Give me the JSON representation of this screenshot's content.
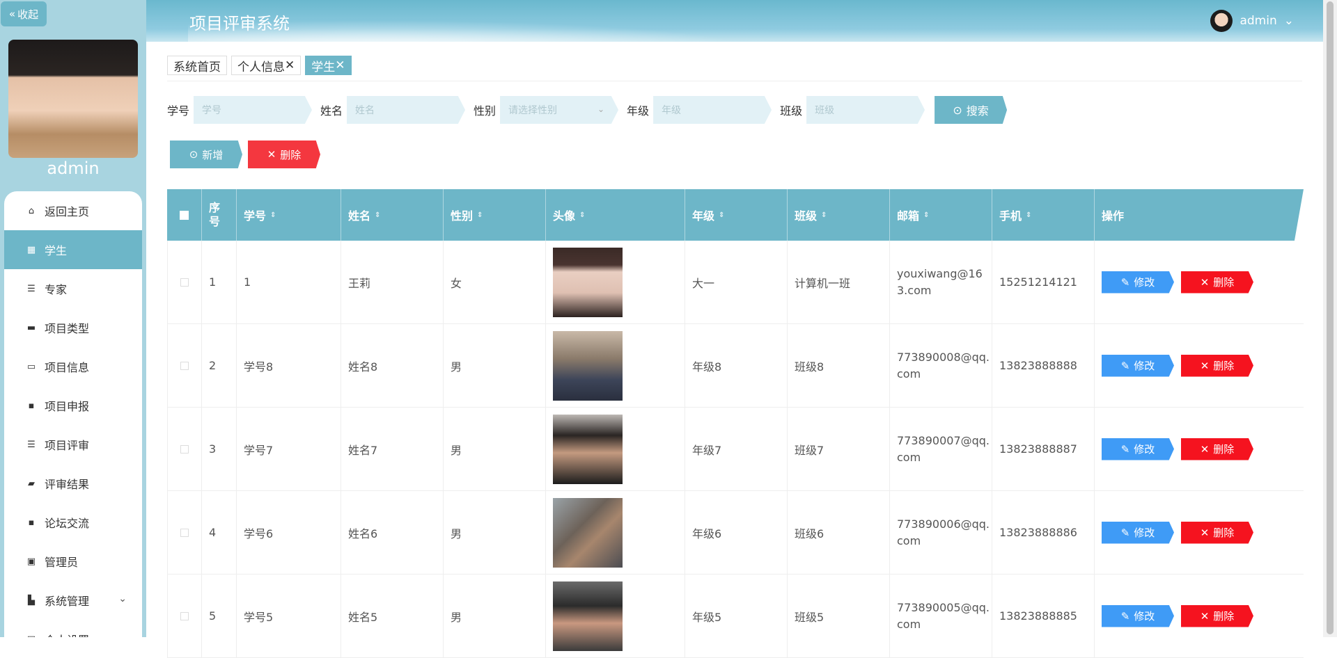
{
  "sidebar": {
    "collapse_label": "收起",
    "profile_name": "admin",
    "items": [
      {
        "label": "返回主页",
        "icon": "home-icon"
      },
      {
        "label": "学生",
        "icon": "grid-icon"
      },
      {
        "label": "专家",
        "icon": "list-icon"
      },
      {
        "label": "项目类型",
        "icon": "briefcase-icon"
      },
      {
        "label": "项目信息",
        "icon": "monitor-icon"
      },
      {
        "label": "项目申报",
        "icon": "apps-icon"
      },
      {
        "label": "项目评审",
        "icon": "list-icon"
      },
      {
        "label": "评审结果",
        "icon": "chat-icon"
      },
      {
        "label": "论坛交流",
        "icon": "apps-icon"
      },
      {
        "label": "管理员",
        "icon": "clipboard-icon"
      },
      {
        "label": "系统管理",
        "icon": "stamp-icon"
      },
      {
        "label": "个人设置",
        "icon": "user-icon"
      }
    ]
  },
  "header": {
    "title": "项目评审系统",
    "user": "admin"
  },
  "tabs": [
    {
      "label": "系统首页",
      "close": ""
    },
    {
      "label": "个人信息",
      "close": "✕"
    },
    {
      "label": "学生",
      "close": "✕"
    }
  ],
  "search": {
    "fields": [
      {
        "label": "学号",
        "placeholder": "学号"
      },
      {
        "label": "姓名",
        "placeholder": "姓名"
      },
      {
        "label": "性别",
        "placeholder": "请选择性别"
      },
      {
        "label": "年级",
        "placeholder": "年级"
      },
      {
        "label": "班级",
        "placeholder": "班级"
      }
    ],
    "button": "搜索"
  },
  "actions": {
    "add": "新增",
    "delete": "删除"
  },
  "table": {
    "headers": [
      "序号",
      "学号",
      "姓名",
      "性别",
      "头像",
      "年级",
      "班级",
      "邮箱",
      "手机",
      "操作"
    ],
    "edit_label": "修改",
    "delete_label": "删除",
    "rows": [
      {
        "index": "1",
        "sid": "1",
        "name": "王莉",
        "gender": "女",
        "grade": "大一",
        "class": "计算机一班",
        "email_1": "youxiwang@16",
        "email_2": "3.com",
        "phone": "15251214121"
      },
      {
        "index": "2",
        "sid": "学号8",
        "name": "姓名8",
        "gender": "男",
        "grade": "年级8",
        "class": "班级8",
        "email_1": "773890008@qq.",
        "email_2": "com",
        "phone": "13823888888"
      },
      {
        "index": "3",
        "sid": "学号7",
        "name": "姓名7",
        "gender": "男",
        "grade": "年级7",
        "class": "班级7",
        "email_1": "773890007@qq.",
        "email_2": "com",
        "phone": "13823888887"
      },
      {
        "index": "4",
        "sid": "学号6",
        "name": "姓名6",
        "gender": "男",
        "grade": "年级6",
        "class": "班级6",
        "email_1": "773890006@qq.",
        "email_2": "com",
        "phone": "13823888886"
      },
      {
        "index": "5",
        "sid": "学号5",
        "name": "姓名5",
        "gender": "男",
        "grade": "年级5",
        "class": "班级5",
        "email_1": "773890005@qq.",
        "email_2": "com",
        "phone": "13823888885"
      }
    ]
  }
}
